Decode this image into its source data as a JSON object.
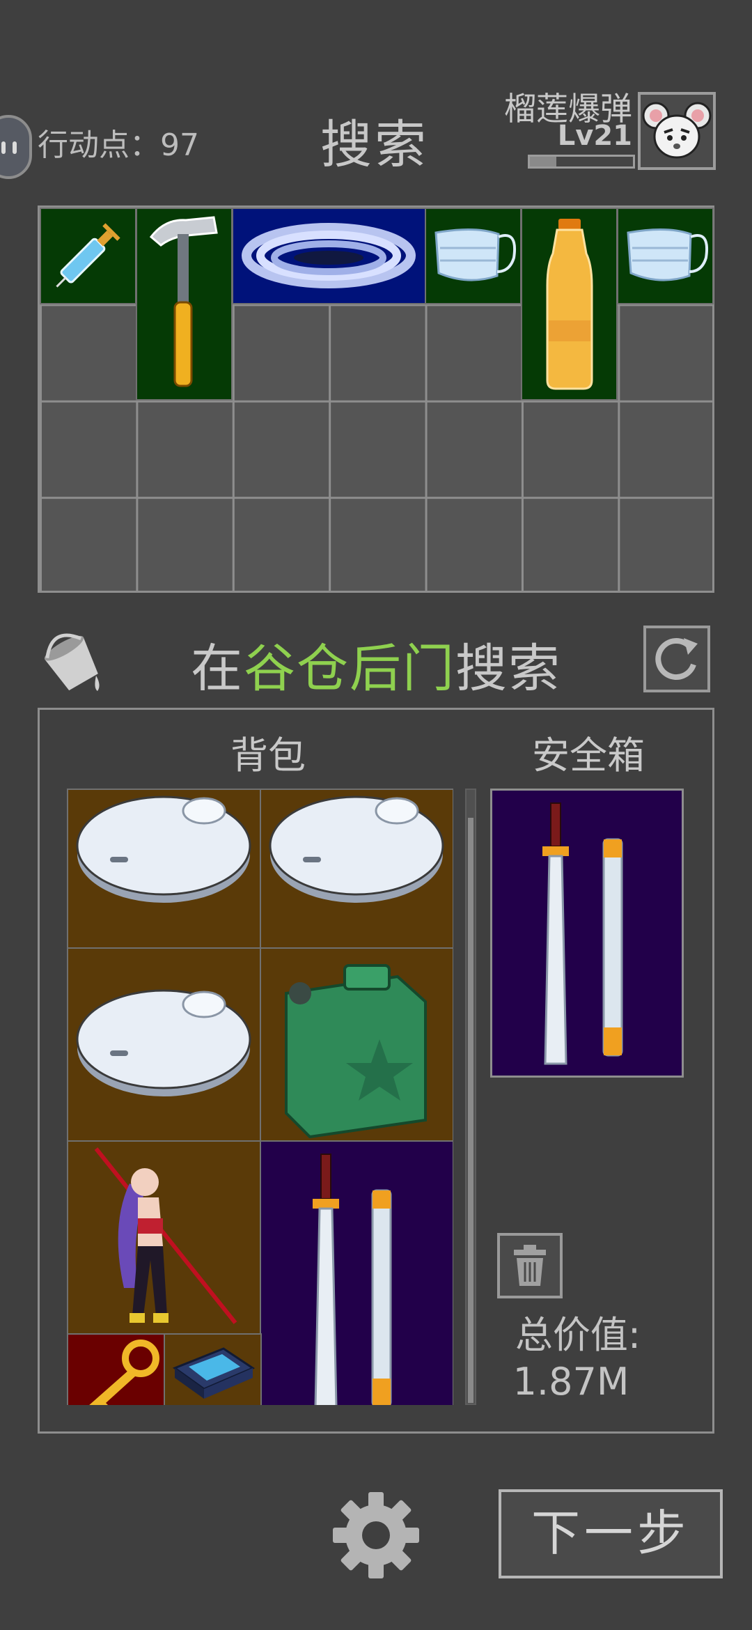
{
  "header": {
    "action_points_label": "行动点：",
    "action_points_value": "97",
    "title": "搜索",
    "username": "榴莲爆弹",
    "level": "Lv21",
    "xp_fraction": 0.26
  },
  "found_items": [
    {
      "icon": "syringe-icon"
    },
    {
      "icon": "hammer-icon"
    },
    {
      "icon": "hose-coil-icon"
    },
    {
      "icon": "face-mask-icon"
    },
    {
      "icon": "oil-bottle-icon"
    },
    {
      "icon": "face-mask-icon"
    }
  ],
  "search": {
    "prefix": "在",
    "location": "谷仓后门",
    "suffix": "搜索"
  },
  "backpack": {
    "title": "背包",
    "items": [
      {
        "icon": "robot-vacuum-icon"
      },
      {
        "icon": "robot-vacuum-icon"
      },
      {
        "icon": "robot-vacuum-icon"
      },
      {
        "icon": "jerrycan-icon"
      },
      {
        "icon": "figurine-icon"
      },
      {
        "icon": "sword-icon"
      },
      {
        "icon": "key-icon"
      },
      {
        "icon": "chip-icon"
      }
    ]
  },
  "safebox": {
    "title": "安全箱",
    "items": [
      {
        "icon": "sword-icon"
      }
    ]
  },
  "total": {
    "label": "总价值:",
    "value": "1.87M"
  },
  "footer": {
    "next_label": "下一步"
  },
  "colors": {
    "background": "#3f3f3f",
    "highlight_text": "#8fd14f",
    "rarity_green": "#053a05",
    "rarity_blue": "#00127a",
    "rarity_purple": "#22004a",
    "rarity_gold": "#5a3a08",
    "rarity_red": "#6a0000"
  }
}
